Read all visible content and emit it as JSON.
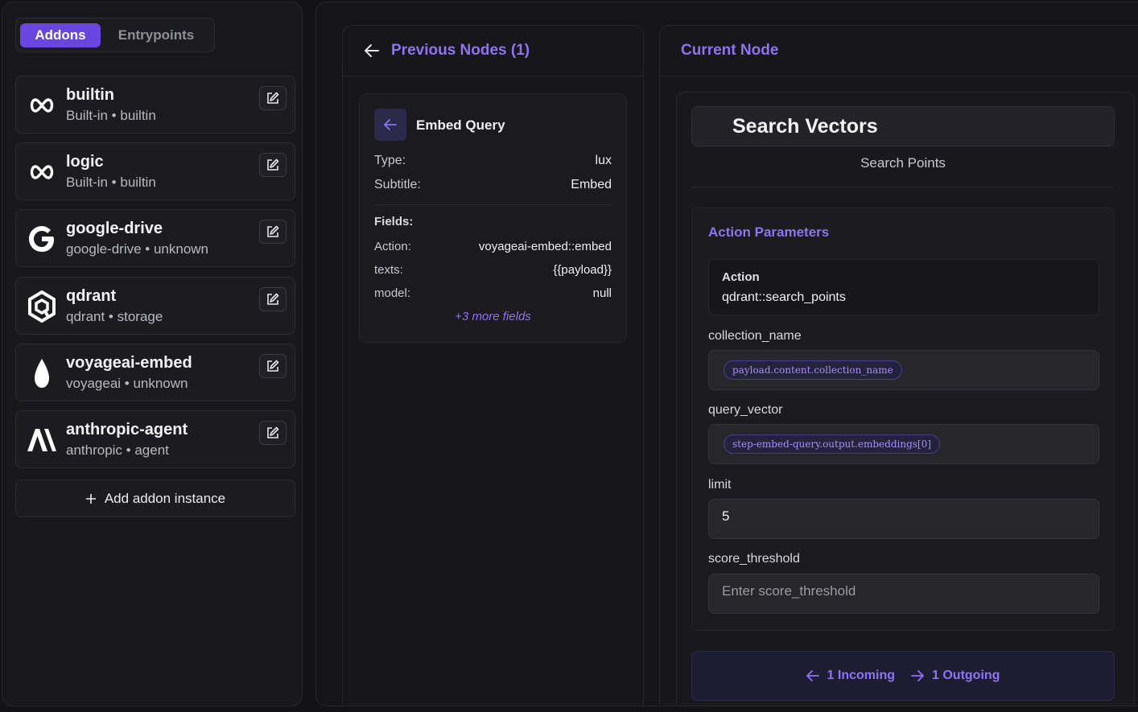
{
  "sidebar": {
    "tabs": [
      {
        "label": "Addons",
        "active": true
      },
      {
        "label": "Entrypoints",
        "active": false
      }
    ],
    "addons": [
      {
        "name": "builtin",
        "subtitle": "Built-in • builtin",
        "icon": "infinity-icon"
      },
      {
        "name": "logic",
        "subtitle": "Built-in • builtin",
        "icon": "infinity-icon"
      },
      {
        "name": "google-drive",
        "subtitle": "google-drive • unknown",
        "icon": "google-g-icon"
      },
      {
        "name": "qdrant",
        "subtitle": "qdrant • storage",
        "icon": "qdrant-hexagon-icon"
      },
      {
        "name": "voyageai-embed",
        "subtitle": "voyageai • unknown",
        "icon": "voyageai-drop-icon"
      },
      {
        "name": "anthropic-agent",
        "subtitle": "anthropic • agent",
        "icon": "anthropic-logo-icon"
      }
    ],
    "add_label": "Add addon instance"
  },
  "previous": {
    "title": "Previous Nodes (1)",
    "card": {
      "title": "Embed Query",
      "type_key": "Type:",
      "type_val": "lux",
      "subtitle_key": "Subtitle:",
      "subtitle_val": "Embed",
      "fields_label": "Fields:",
      "fields": [
        {
          "k": "Action:",
          "v": "voyageai-embed::embed"
        },
        {
          "k": "texts:",
          "v": "{{payload}}"
        },
        {
          "k": "model:",
          "v": "null"
        }
      ],
      "more": "+3 more fields"
    }
  },
  "current": {
    "title": "Current Node",
    "node_title": "Search Vectors",
    "node_subtitle": "Search Points",
    "params_title": "Action Parameters",
    "action_label": "Action",
    "action_value": "qdrant::search_points",
    "fields": {
      "collection_name": {
        "label": "collection_name",
        "pill": "payload.content.collection_name"
      },
      "query_vector": {
        "label": "query_vector",
        "pill": "step-embed-query.output.embeddings[0]"
      },
      "limit": {
        "label": "limit",
        "value": "5"
      },
      "score_threshold": {
        "label": "score_threshold",
        "placeholder": "Enter score_threshold"
      }
    },
    "incoming": "1 Incoming",
    "outgoing": "1 Outgoing"
  },
  "colors": {
    "accent": "#8e73f2",
    "tab_active": "#6a46e0"
  }
}
